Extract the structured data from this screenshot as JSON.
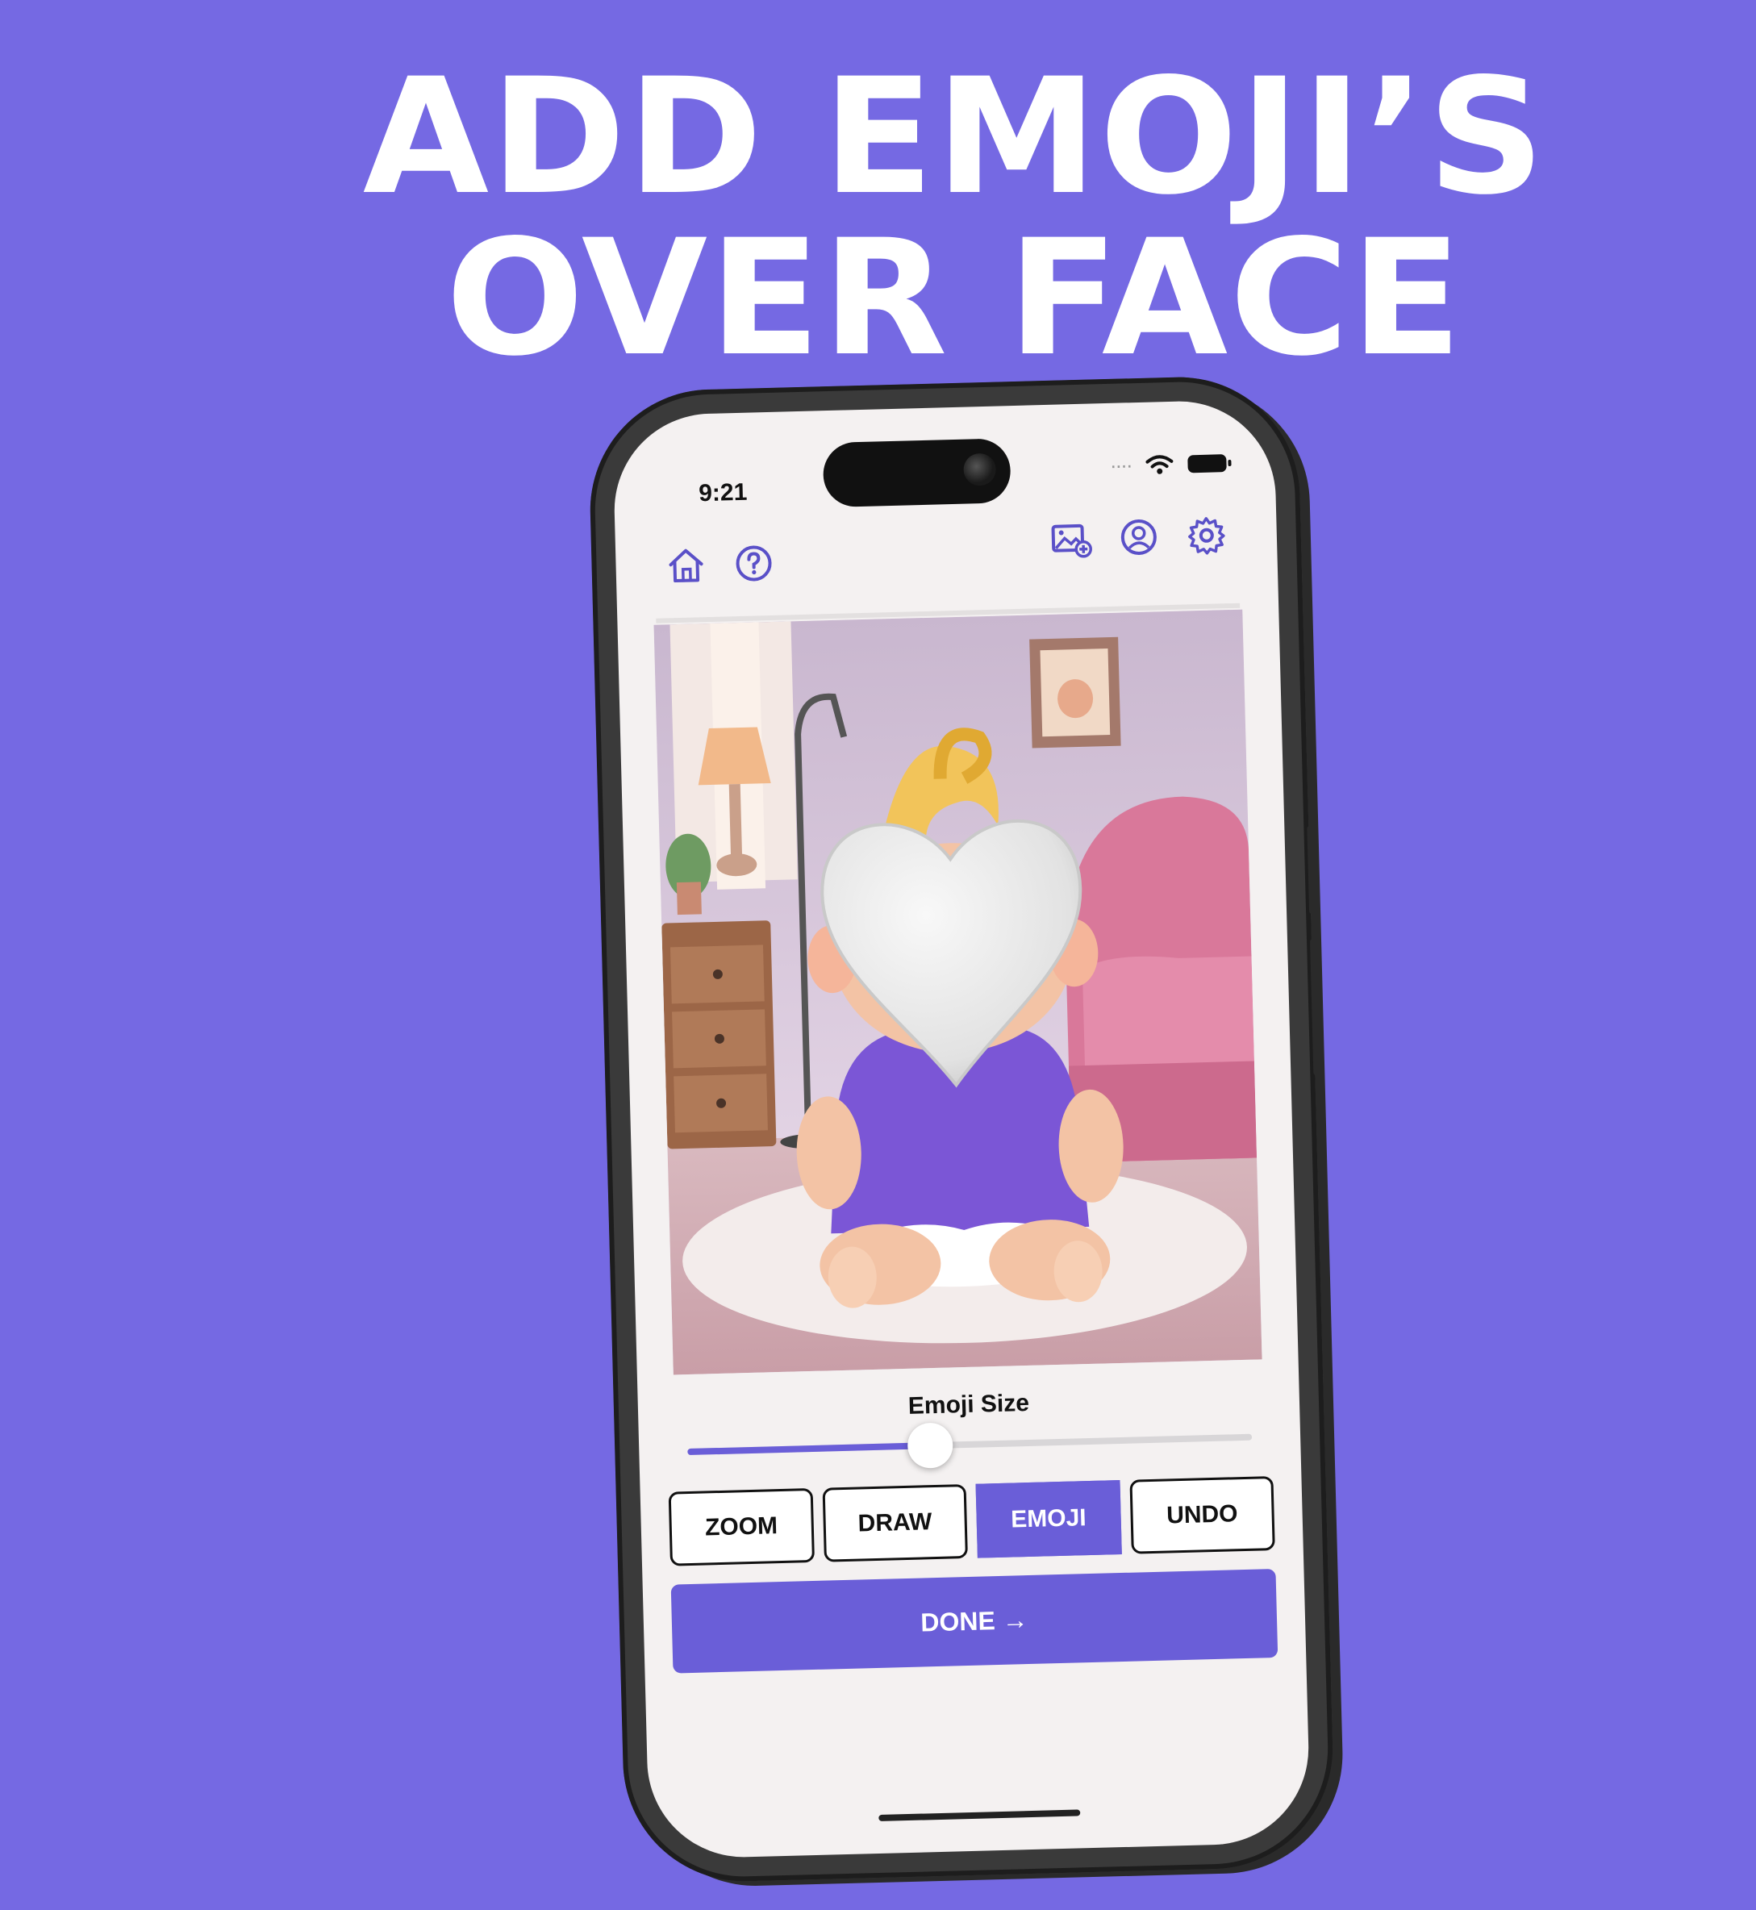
{
  "headline": {
    "line1": "ADD EMOJI’S",
    "line2": "OVER FACE"
  },
  "status_bar": {
    "time": "9:21",
    "signal": "····"
  },
  "toolbar": {
    "left_icons": [
      "home-icon",
      "help-icon"
    ],
    "right_icons": [
      "add-photo-icon",
      "profile-icon",
      "settings-icon"
    ]
  },
  "slider": {
    "label": "Emoji Size",
    "value": 0.43
  },
  "modes": [
    "ZOOM",
    "DRAW",
    "EMOJI",
    "UNDO"
  ],
  "active_mode": "EMOJI",
  "done_label": "DONE →",
  "colors": {
    "background": "#7569e3",
    "accent": "#6a5ed8",
    "screen": "#f4f1f1"
  }
}
